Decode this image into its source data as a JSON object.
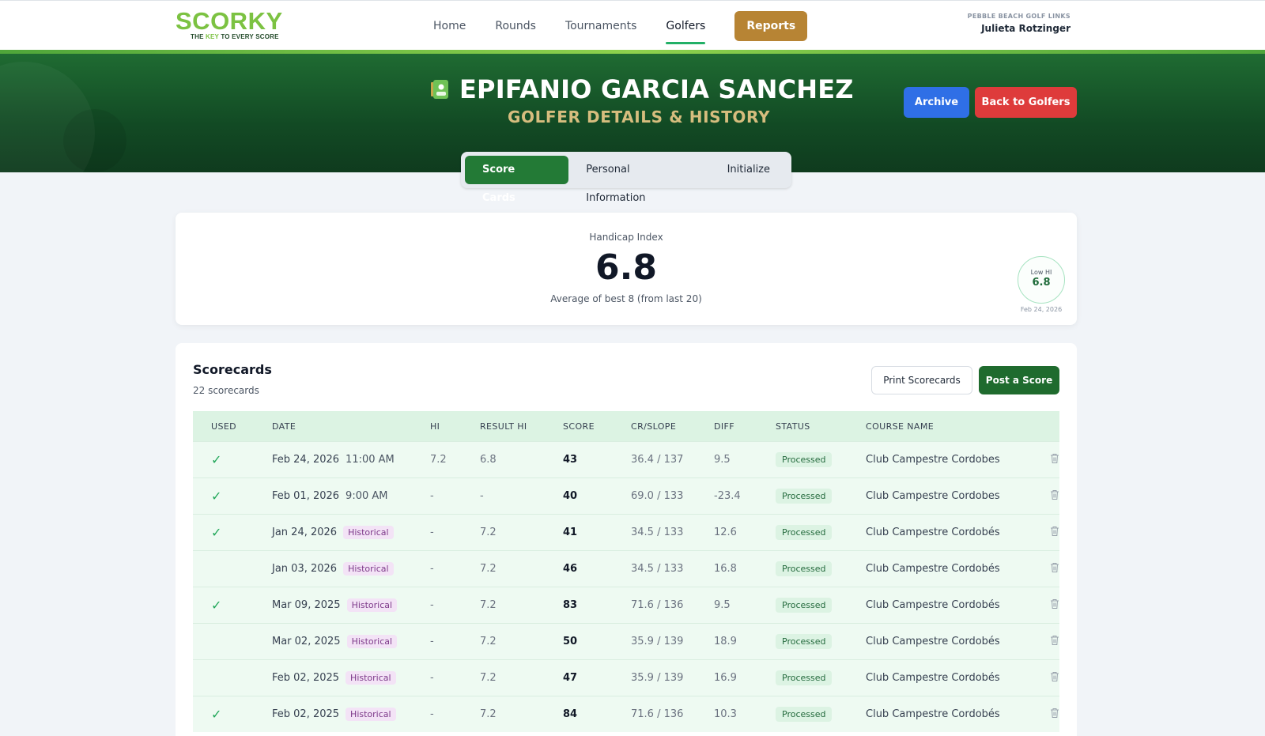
{
  "brand": {
    "logo_main": "SCORKY",
    "logo_tag_pre": "THE ",
    "logo_tag_key": "KEY",
    "logo_tag_post": " TO EVERY SCORE",
    "accent": "#7cc242"
  },
  "nav": {
    "items": [
      {
        "label": "Home"
      },
      {
        "label": "Rounds"
      },
      {
        "label": "Tournaments"
      },
      {
        "label": "Golfers",
        "active": true
      }
    ],
    "reports_label": "Reports"
  },
  "account": {
    "club": "PEBBLE BEACH GOLF LINKS",
    "user": "Julieta Rotzinger",
    "caret": "⌄"
  },
  "hero": {
    "title": "EPIFANIO GARCIA SANCHEZ",
    "subtitle": "GOLFER DETAILS & HISTORY",
    "archive_label": "Archive",
    "back_label": "Back to Golfers"
  },
  "tabs": [
    {
      "label": "Score Cards",
      "active": true
    },
    {
      "label": "Personal Information"
    },
    {
      "label": "Initialize"
    }
  ],
  "handicap": {
    "label": "Handicap Index",
    "value": "6.8",
    "note": "Average of best 8 (from last 20)",
    "low_label": "Low HI",
    "low_value": "6.8",
    "low_date": "Feb 24, 2026"
  },
  "scorecards": {
    "title": "Scorecards",
    "count": "22 scorecards",
    "print_label": "Print Scorecards",
    "post_label": "Post a Score",
    "columns": [
      "USED",
      "DATE",
      "HI",
      "RESULT HI",
      "SCORE",
      "CR/SLOPE",
      "DIFF",
      "STATUS",
      "COURSE NAME"
    ],
    "rows": [
      {
        "used": "✓",
        "date": "Feb 24, 2026",
        "time": "11:00 AM",
        "tag": "",
        "hi": "7.2",
        "result_hi": "6.8",
        "score": "43",
        "cr_slope": "36.4 / 137",
        "diff": "9.5",
        "status": "Processed",
        "course": "Club Campestre Cordobes"
      },
      {
        "used": "✓",
        "date": "Feb 01, 2026",
        "time": "9:00 AM",
        "tag": "",
        "hi": "-",
        "result_hi": "-",
        "score": "40",
        "cr_slope": "69.0 / 133",
        "diff": "-23.4",
        "status": "Processed",
        "course": "Club Campestre Cordobes"
      },
      {
        "used": "✓",
        "date": "Jan 24, 2026",
        "time": "",
        "tag": "Historical",
        "hi": "-",
        "result_hi": "7.2",
        "score": "41",
        "cr_slope": "34.5 / 133",
        "diff": "12.6",
        "status": "Processed",
        "course": "Club Campestre Cordobés"
      },
      {
        "used": "",
        "date": "Jan 03, 2026",
        "time": "",
        "tag": "Historical",
        "hi": "-",
        "result_hi": "7.2",
        "score": "46",
        "cr_slope": "34.5 / 133",
        "diff": "16.8",
        "status": "Processed",
        "course": "Club Campestre Cordobés"
      },
      {
        "used": "✓",
        "date": "Mar 09, 2025",
        "time": "",
        "tag": "Historical",
        "hi": "-",
        "result_hi": "7.2",
        "score": "83",
        "cr_slope": "71.6 / 136",
        "diff": "9.5",
        "status": "Processed",
        "course": "Club Campestre Cordobés"
      },
      {
        "used": "",
        "date": "Mar 02, 2025",
        "time": "",
        "tag": "Historical",
        "hi": "-",
        "result_hi": "7.2",
        "score": "50",
        "cr_slope": "35.9 / 139",
        "diff": "18.9",
        "status": "Processed",
        "course": "Club Campestre Cordobés"
      },
      {
        "used": "",
        "date": "Feb 02, 2025",
        "time": "",
        "tag": "Historical",
        "hi": "-",
        "result_hi": "7.2",
        "score": "47",
        "cr_slope": "35.9 / 139",
        "diff": "16.9",
        "status": "Processed",
        "course": "Club Campestre Cordobés"
      },
      {
        "used": "✓",
        "date": "Feb 02, 2025",
        "time": "",
        "tag": "Historical",
        "hi": "-",
        "result_hi": "7.2",
        "score": "84",
        "cr_slope": "71.6 / 136",
        "diff": "10.3",
        "status": "Processed",
        "course": "Club Campestre Cordobés"
      }
    ]
  }
}
